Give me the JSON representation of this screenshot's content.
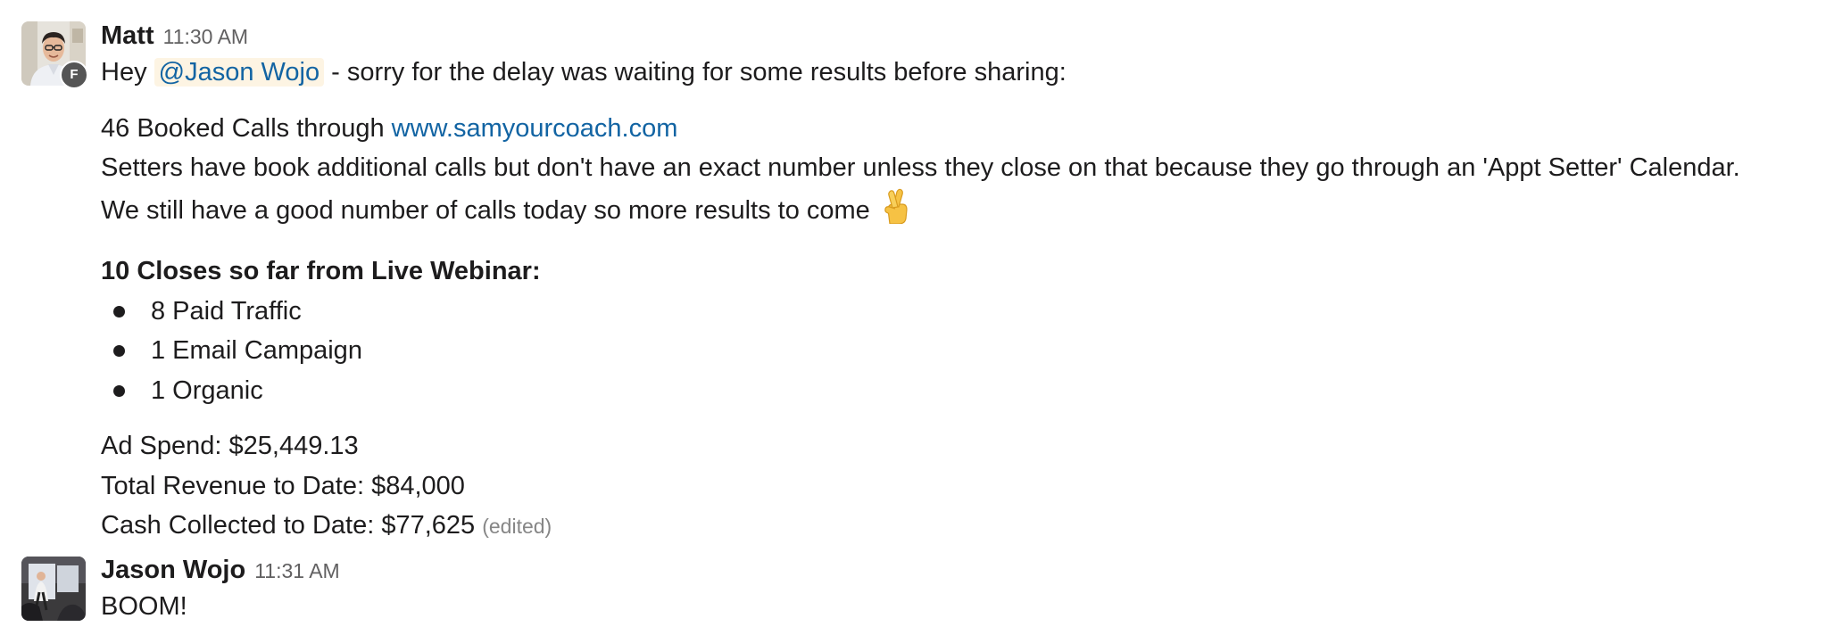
{
  "messages": [
    {
      "author": "Matt",
      "time": "11:30 AM",
      "badge": "F",
      "p1": {
        "prefix": "Hey ",
        "mention": "@Jason Wojo",
        "suffix": " - sorry for the delay was waiting for some results before sharing:"
      },
      "p2": {
        "booked_prefix": "46 Booked Calls through ",
        "booked_link": "www.samyourcoach.com",
        "setters": "Setters have book additional calls but don't have an exact number unless they close on that because they go through an 'Appt Setter' Calendar.",
        "still": "We still have a good number of calls today so more results to come "
      },
      "p3": {
        "heading": "10 Closes so far from Live Webinar:",
        "bullets": [
          "8 Paid Traffic",
          "1 Email Campaign",
          "1 Organic"
        ]
      },
      "p4": {
        "ad_spend": "Ad Spend: $25,449.13",
        "revenue": "Total Revenue to Date: $84,000",
        "cash": "Cash Collected to Date: $77,625",
        "edited": "(edited)"
      }
    },
    {
      "author": "Jason Wojo",
      "time": "11:31 AM",
      "text": "BOOM!"
    }
  ]
}
